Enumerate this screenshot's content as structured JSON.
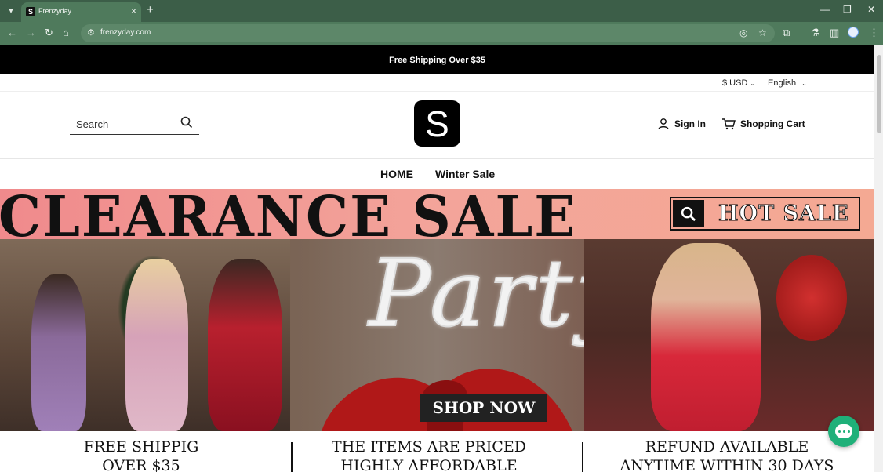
{
  "browser": {
    "tab_title": "Frenzyday",
    "favicon_letter": "S",
    "url": "frenzyday.com"
  },
  "site": {
    "announcement": "Free Shipping Over $35",
    "currency": "$ USD",
    "language": "English",
    "search_placeholder": "Search",
    "logo_letter": "S",
    "sign_in": "Sign In",
    "cart": "Shopping Cart",
    "nav": [
      "HOME",
      "Winter Sale"
    ]
  },
  "banners": {
    "clearance_text": "CLEARANCE SALE",
    "hot_sale": "HOT SALE",
    "party_text": "Party",
    "shop_now": "SHOP NOW"
  },
  "features": [
    {
      "line1": "FREE SHIPPIG",
      "line2": "OVER $35"
    },
    {
      "line1": "THE ITEMS ARE PRICED",
      "line2": "HIGHLY AFFORDABLE"
    },
    {
      "line1": "REFUND AVAILABLE",
      "line2": "ANYTIME WITHIN 30 DAYS"
    }
  ],
  "colors": {
    "browser_frame": "#3c5e48",
    "clearance_bg": "#f3a49a",
    "chat_button": "#1fb079"
  }
}
